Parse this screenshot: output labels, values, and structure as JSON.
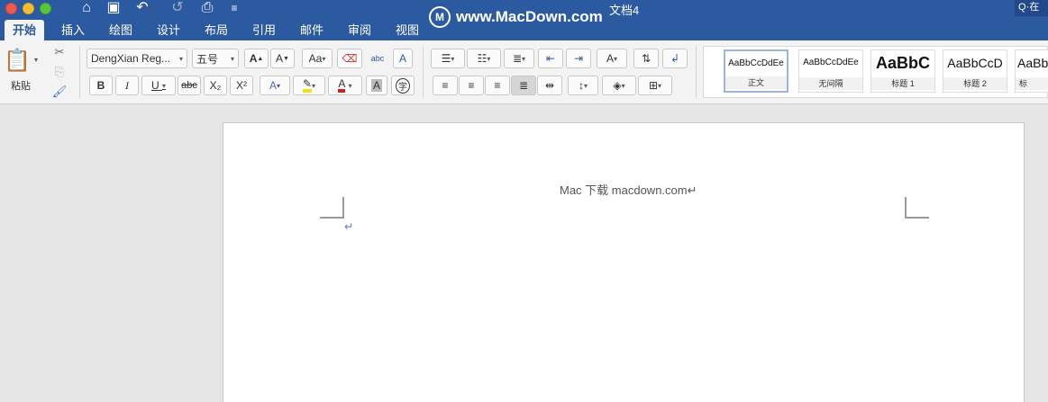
{
  "window": {
    "title": "文档4"
  },
  "quick_access": {
    "home_icon": "home-icon",
    "save_icon": "save-icon",
    "undo_icon": "undo-icon",
    "redo_icon": "redo-icon",
    "print_icon": "print-icon",
    "customize_icon": "customize-icon"
  },
  "search": {
    "label": "Q·在"
  },
  "watermark": {
    "logo": "M",
    "text": "www.MacDown.com"
  },
  "tabs": [
    {
      "label": "开始"
    },
    {
      "label": "插入"
    },
    {
      "label": "绘图"
    },
    {
      "label": "设计"
    },
    {
      "label": "布局"
    },
    {
      "label": "引用"
    },
    {
      "label": "邮件"
    },
    {
      "label": "审阅"
    },
    {
      "label": "视图"
    }
  ],
  "clipboard": {
    "paste_label": "粘贴"
  },
  "font": {
    "name": "DengXian Reg...",
    "size": "五号"
  },
  "font_buttons": {
    "bold": "B",
    "italic": "I",
    "underline": "U",
    "strike": "abc",
    "subscript": "X₂",
    "superscript": "X²",
    "grow": "A",
    "shrink": "A",
    "change_case": "Aa",
    "font_color": "A",
    "shading": "A",
    "phonetic": "abc",
    "border": "A",
    "enclose": "字"
  },
  "styles": [
    {
      "sample": "AaBbCcDdEe",
      "name": "正文"
    },
    {
      "sample": "AaBbCcDdEe",
      "name": "无间隔"
    },
    {
      "sample": "AaBbC",
      "name": "标题 1"
    },
    {
      "sample": "AaBbCcD",
      "name": "标题 2"
    },
    {
      "sample": "AaBb",
      "name": "标"
    }
  ],
  "document": {
    "text": "Mac 下载 macdown.com↵",
    "para_mark": "↵"
  },
  "colors": {
    "accent": "#2c5aa0",
    "highlight": "#f3e01a",
    "font_red": "#d21f1f"
  }
}
